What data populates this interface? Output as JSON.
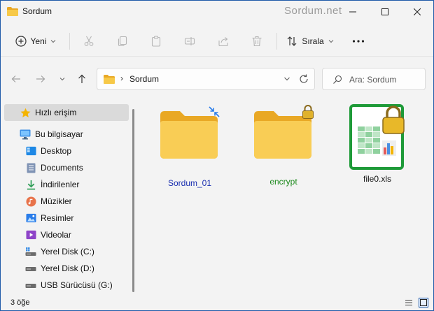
{
  "window": {
    "title": "Sordum",
    "watermark": "Sordum.net"
  },
  "toolbar": {
    "new_label": "Yeni",
    "sort_label": "Sırala"
  },
  "address": {
    "path": "Sordum",
    "search_placeholder": "Ara: Sordum"
  },
  "sidebar": {
    "items": [
      {
        "label": "Hızlı erişim",
        "icon": "star-icon"
      },
      {
        "label": "Bu bilgisayar",
        "icon": "computer-icon"
      },
      {
        "label": "Desktop",
        "icon": "desktop-icon"
      },
      {
        "label": "Documents",
        "icon": "documents-icon"
      },
      {
        "label": "İndirilenler",
        "icon": "download-icon"
      },
      {
        "label": "Müzikler",
        "icon": "music-icon"
      },
      {
        "label": "Resimler",
        "icon": "pictures-icon"
      },
      {
        "label": "Videolar",
        "icon": "videos-icon"
      },
      {
        "label": "Yerel Disk (C:)",
        "icon": "drive-icon"
      },
      {
        "label": "Yerel Disk (D:)",
        "icon": "drive-icon"
      },
      {
        "label": "USB Sürücüsü (G:)",
        "icon": "usb-drive-icon"
      }
    ]
  },
  "files": [
    {
      "name": "Sordum_01",
      "type": "folder",
      "overlay": "compressed-arrows-icon",
      "label_color": "#1a2fb0"
    },
    {
      "name": "encrypt",
      "type": "folder",
      "overlay": "lock-icon",
      "label_color": "#1e8a1e"
    },
    {
      "name": "file0.xls",
      "type": "spreadsheet",
      "overlay": "lock-icon",
      "label_color": "#111111"
    }
  ],
  "status": {
    "item_count": "3 öğe"
  },
  "colors": {
    "folder": "#f7c948",
    "accent": "#1f5aa8",
    "excel_green": "#1e7a3a"
  }
}
